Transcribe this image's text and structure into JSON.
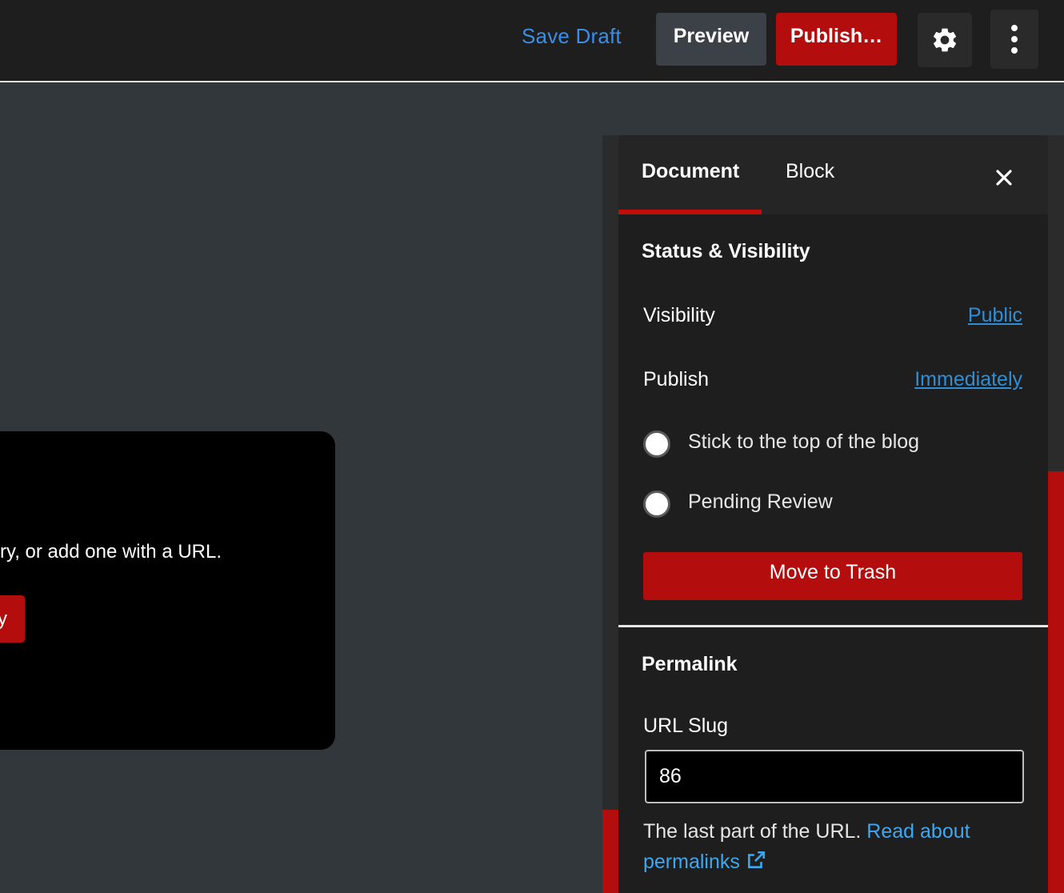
{
  "topbar": {
    "save_draft": "Save Draft",
    "preview": "Preview",
    "publish": "Publish…"
  },
  "card": {
    "text": "ry, or add one with a URL.",
    "button_label": "y"
  },
  "sidebar": {
    "tabs": [
      {
        "label": "Document",
        "active": true
      },
      {
        "label": "Block",
        "active": false
      }
    ],
    "status_section": {
      "title": "Status & Visibility",
      "visibility_label": "Visibility",
      "visibility_value": "Public",
      "publish_label": "Publish",
      "publish_value": "Immediately",
      "toggles": [
        {
          "label": "Stick to the top of the blog"
        },
        {
          "label": "Pending Review"
        }
      ],
      "trash_button": "Move to Trash"
    },
    "permalink_section": {
      "title": "Permalink",
      "slug_label": "URL Slug",
      "slug_value": "86",
      "help_text": "The last part of the URL. ",
      "help_link": "Read about permalinks"
    }
  },
  "colors": {
    "accent_red": "#b30d0d",
    "link_blue": "#2f8ed8",
    "background": "#32373c"
  }
}
